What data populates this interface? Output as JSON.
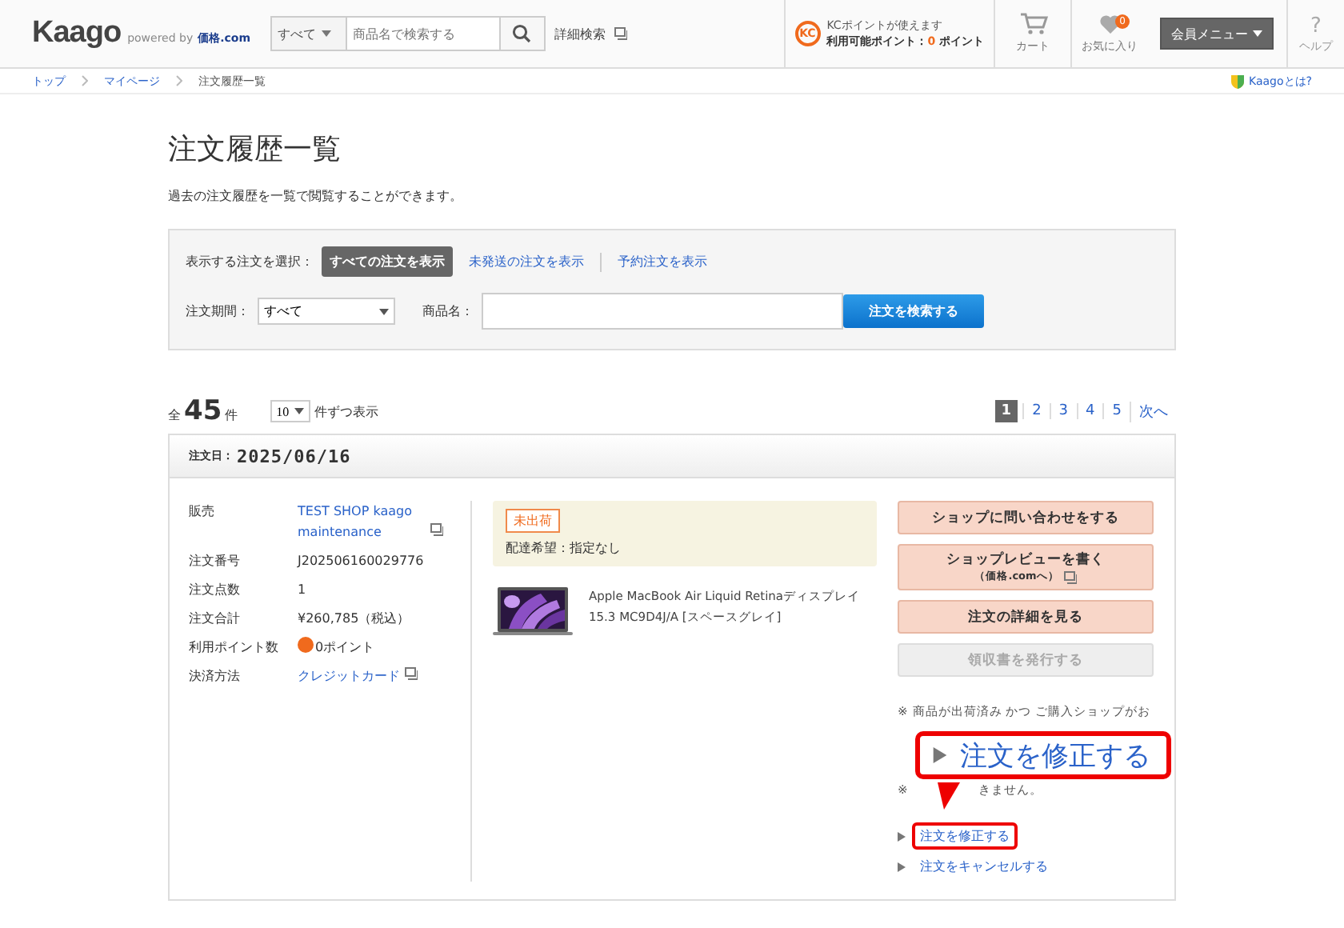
{
  "header": {
    "logo": "Kaago",
    "powered_by": "powered by",
    "partner": "価格.com",
    "search": {
      "category": "すべて",
      "placeholder": "商品名で検索する"
    },
    "advanced_search": "詳細検索",
    "points": {
      "badge": "KC",
      "line1": "KCポイントが使えます",
      "label": "利用可能ポイント：",
      "value": "0",
      "unit": "ポイント"
    },
    "nav": [
      {
        "kind": "cart",
        "label": "カート"
      },
      {
        "kind": "favorite",
        "label": "お気に入り",
        "count": "0"
      }
    ],
    "member_menu": "会員メニュー",
    "help": {
      "mark": "?",
      "label": "ヘルプ"
    }
  },
  "breadcrumb": [
    {
      "label": "トップ",
      "link": true
    },
    {
      "label": "マイページ",
      "link": true
    },
    {
      "label": "注文履歴一覧",
      "link": false
    }
  ],
  "about_link": "Kaagoとは?",
  "page_title": "注文履歴一覧",
  "page_subtitle": "過去の注文履歴を一覧で閲覧することができます。",
  "filter": {
    "label": "表示する注文を選択：",
    "options": [
      {
        "label": "すべての注文を表示",
        "selected": true
      },
      {
        "label": "未発送の注文を表示",
        "selected": false
      },
      {
        "label": "予約注文を表示",
        "selected": false
      }
    ],
    "period_label": "注文期間：",
    "period_value": "すべて",
    "product_label": "商品名：",
    "search_button": "注文を検索する"
  },
  "summary": {
    "prefix": "全",
    "count": "45",
    "suffix": "件",
    "per_page": "10",
    "per_page_label": "件ずつ表示"
  },
  "pagination": [
    {
      "label": "1",
      "selected": true
    },
    {
      "label": "2",
      "selected": false
    },
    {
      "label": "3",
      "selected": false
    },
    {
      "label": "4",
      "selected": false
    },
    {
      "label": "5",
      "selected": false
    },
    {
      "label": "次へ",
      "selected": false
    }
  ],
  "order": {
    "date_label": "注文日：",
    "date": "2025/06/16",
    "details": [
      {
        "label": "販売",
        "value": "TEST SHOP kaago maintenance",
        "kind": "link"
      },
      {
        "label": "注文番号",
        "value": "J202506160029776",
        "kind": "text"
      },
      {
        "label": "注文点数",
        "value": "1",
        "kind": "text"
      },
      {
        "label": "注文合計",
        "value": "¥260,785（税込）",
        "kind": "text"
      },
      {
        "label": "利用ポイント数",
        "value": "0ポイント",
        "kind": "points"
      },
      {
        "label": "決済方法",
        "value": "クレジットカード",
        "kind": "link"
      }
    ],
    "status": "未出荷",
    "delivery": "配達希望：指定なし",
    "product": {
      "name": "Apple MacBook Air Liquid Retinaディスプレイ 15.3 MC9D4J/A [スペースグレイ]"
    },
    "actions": [
      {
        "label": "ショップに問い合わせをする",
        "disabled": false
      },
      {
        "label": "ショップレビューを書く",
        "sub": "（価格.comへ）",
        "disabled": false
      },
      {
        "label": "注文の詳細を見る",
        "disabled": false
      },
      {
        "label": "領収書を発行する",
        "disabled": true
      }
    ],
    "notes": [
      {
        "mark": "※",
        "text": "商品が出荷済み かつ ご購入ショップがお"
      },
      {
        "mark": "※",
        "text": "きません。"
      }
    ],
    "links": [
      {
        "label": "注文を修正する",
        "highlighted": true
      },
      {
        "label": "注文をキャンセルする",
        "highlighted": false
      }
    ],
    "callout": {
      "label": "注文を修正する"
    }
  }
}
